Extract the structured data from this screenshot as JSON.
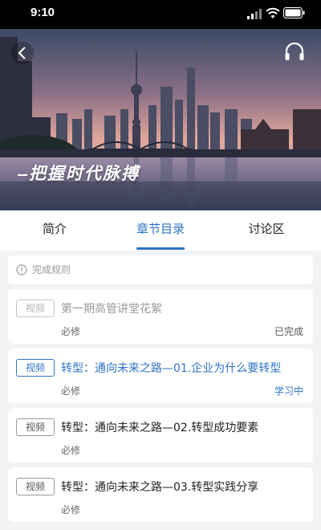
{
  "status_bar": {
    "time": "9:10"
  },
  "hero": {
    "slogan": "把握时代脉搏",
    "back_icon": "chevron-left-icon",
    "audio_icon": "headphones-icon"
  },
  "tabs": [
    {
      "label": "简介",
      "active": false
    },
    {
      "label": "章节目录",
      "active": true
    },
    {
      "label": "讨论区",
      "active": false
    }
  ],
  "rules": {
    "icon": "info-icon",
    "label": "完成规则"
  },
  "chapters": [
    {
      "badge": "视频",
      "title": "第一期高管讲堂花絮",
      "requirement": "必修",
      "status": "已完成",
      "state": "done"
    },
    {
      "badge": "视频",
      "title": "转型：通向未来之路—01.企业为什么要转型",
      "requirement": "必修",
      "status": "学习中",
      "state": "learning"
    },
    {
      "badge": "视频",
      "title": "转型：通向未来之路—02.转型成功要素",
      "requirement": "必修",
      "status": "",
      "state": "normal"
    },
    {
      "badge": "视频",
      "title": "转型：通向未来之路—03.转型实践分享",
      "requirement": "必修",
      "status": "",
      "state": "normal"
    }
  ],
  "colors": {
    "accent": "#2f73c5",
    "done_text": "#9a9a9a",
    "background": "#f2f3f5"
  }
}
